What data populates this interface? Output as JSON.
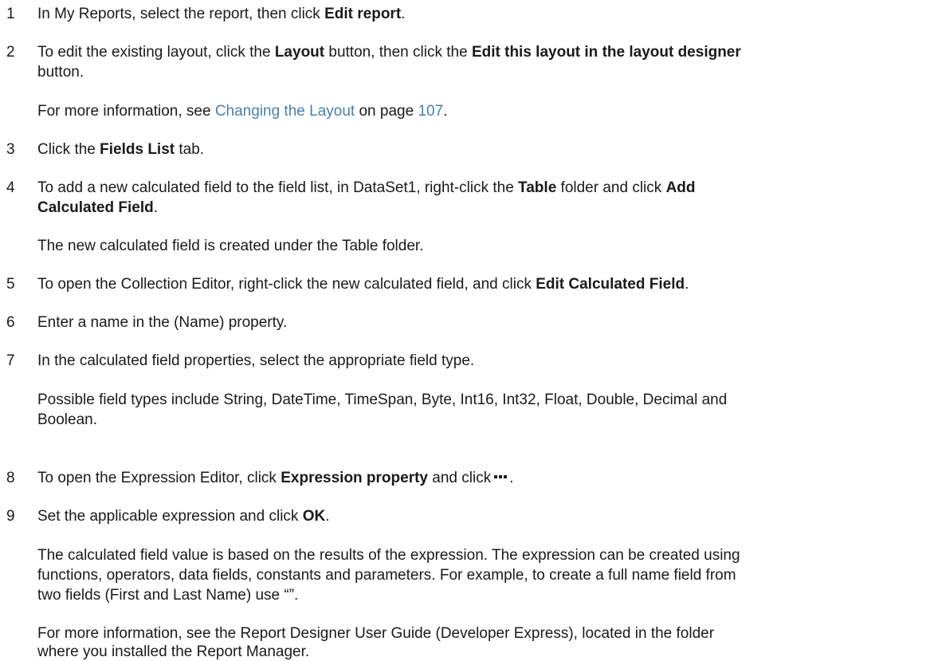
{
  "steps": [
    {
      "num": "1",
      "pre": "In My Reports, select the report, then click ",
      "bold": "Edit report",
      "post": "."
    },
    {
      "num": "2",
      "pre": "To edit the existing layout, click the ",
      "bold1": "Layout",
      "mid": " button, then click the ",
      "bold2": "Edit this layout in the layout designer",
      "cont": "button."
    },
    {
      "num": "3",
      "pre": "Click the ",
      "bold": "Fields List",
      "post": " tab."
    },
    {
      "num": "4",
      "pre": "To add a new calculated field to the field list, in DataSet1, right-click the ",
      "bold1": "Table",
      "mid": " folder and click ",
      "bold2": "Add",
      "cont_bold": "Calculated Field",
      "cont_post": "."
    },
    {
      "num": "5",
      "pre": "To open the Collection Editor, right-click the new calculated field, and click ",
      "bold": "Edit Calculated Field",
      "post": "."
    },
    {
      "num": "6",
      "text": "Enter a name in the (Name) property."
    },
    {
      "num": "7",
      "text": "In the calculated field properties, select the appropriate field type."
    },
    {
      "num": "8",
      "pre": "To open the Expression Editor, click ",
      "bold1": "Expression property",
      "mid": " and click",
      "post": "."
    },
    {
      "num": "9",
      "pre": "Set the applicable expression and click ",
      "bold": "OK",
      "post": "."
    }
  ],
  "notes": {
    "step2_pre": "For more information, see ",
    "step2_link": "Changing the Layout",
    "step2_mid": " on page ",
    "step2_page": "107",
    "step2_post": ".",
    "step4": "The new calculated field is created under the Table folder.",
    "step7_line1": "Possible field types include String, DateTime, TimeSpan, Byte, Int16, Int32, Float, Double, Decimal and",
    "step7_line2": "Boolean.",
    "step9a_line1": "The calculated field value is based on the results of the expression. The expression can be created using",
    "step9a_line2": "functions, operators, data fields, constants and parameters. For example, to create a full name field from",
    "step9a_line3": "two fields (First and Last Name) use “”.",
    "step9b_line1": "For more information, see the Report Designer User Guide (Developer Express), located in the folder",
    "step9b_line2": "where you installed the Report Manager."
  },
  "icons": {
    "ellipsis": "ellipsis-icon"
  }
}
